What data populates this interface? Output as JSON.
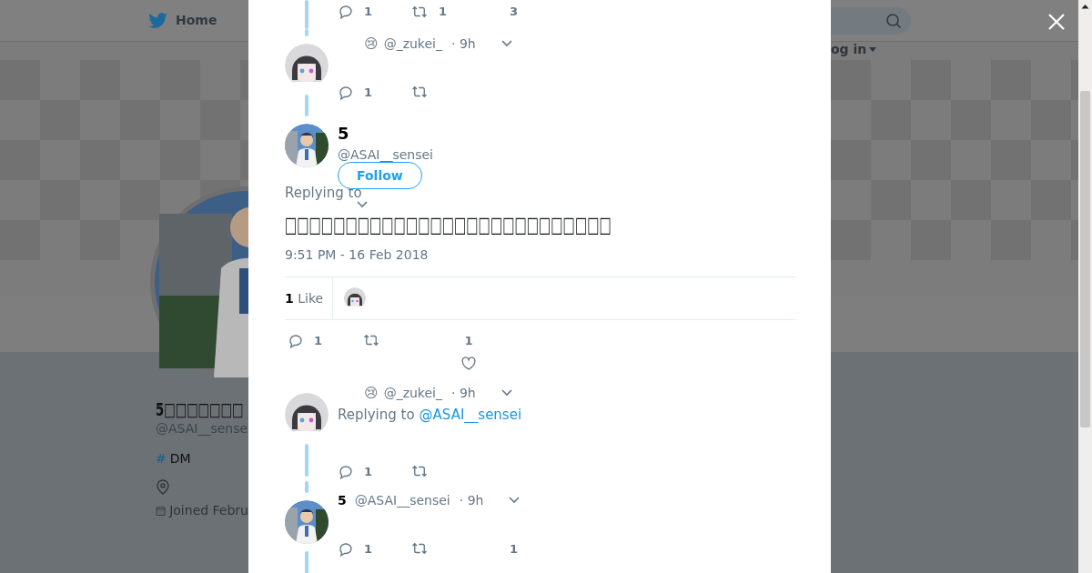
{
  "nav": {
    "home": "Home",
    "login": "og in"
  },
  "profile": {
    "name": "5□□□□□□□",
    "handle": "@ASAI__sense",
    "hash": "#",
    "hashtag": "DM",
    "joined": "Joined Febru"
  },
  "top_actions": {
    "reply": "1",
    "retweet": "1",
    "like": "3"
  },
  "tweets": [
    {
      "kind": "compact",
      "avatar": {
        "kind": "girl"
      },
      "emoji": "😢",
      "handle": "@_zukei_",
      "time": "· 9h",
      "actions": {
        "reply": "1"
      }
    },
    {
      "kind": "focused",
      "avatar": {
        "kind": "teacher"
      },
      "name": "5",
      "handle": "@ASAI__sensei",
      "follow": "Follow",
      "replying": "Replying to",
      "text": "□□□□□□□□□□□□□□□□□□□□□□□□□□□",
      "timestamp": "9:51 PM - 16 Feb 2018",
      "likes_count": "1",
      "likes_label": "Like",
      "actions": {
        "reply": "1",
        "like": "1"
      }
    },
    {
      "kind": "compact",
      "avatar": {
        "kind": "girl"
      },
      "emoji": "😢",
      "handle": "@_zukei_",
      "time": "· 9h",
      "replying": "Replying to",
      "replying_link": "@ASAI__sensei",
      "actions": {
        "reply": "1"
      }
    },
    {
      "kind": "compact",
      "avatar": {
        "kind": "teacher"
      },
      "name": "5",
      "handle": "@ASAI__sensei",
      "time": "· 9h",
      "actions": {
        "reply": "1",
        "like": "1"
      }
    }
  ]
}
